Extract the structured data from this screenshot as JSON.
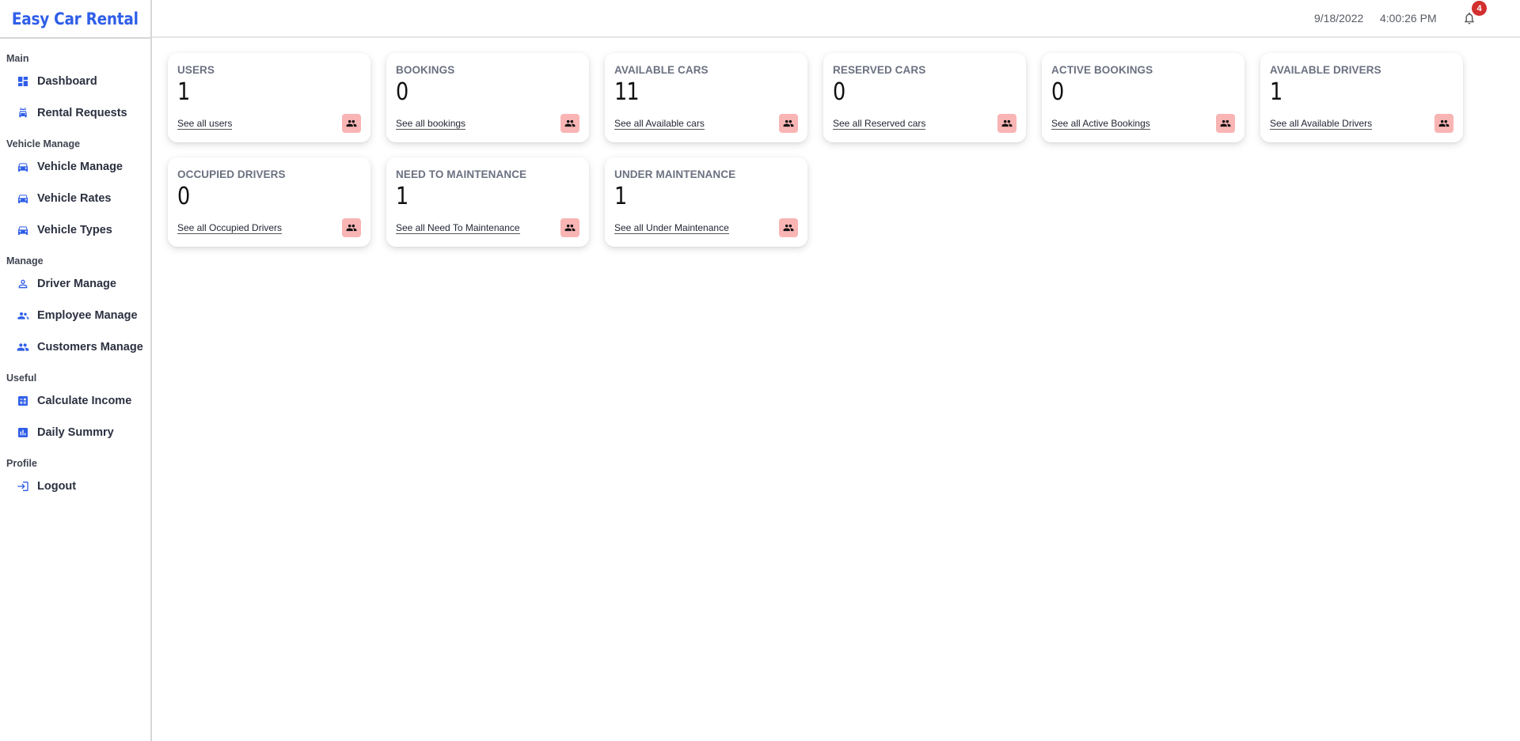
{
  "app": {
    "title": "Easy Car Rental"
  },
  "topbar": {
    "date": "9/18/2022",
    "time": "4:00:26 PM",
    "notification_count": "4"
  },
  "sidebar": {
    "sections": [
      {
        "label": "Main",
        "items": [
          {
            "label": "Dashboard",
            "icon": "dashboard-icon"
          },
          {
            "label": "Rental Requests",
            "icon": "car-rental-icon"
          }
        ]
      },
      {
        "label": "Vehicle Manage",
        "items": [
          {
            "label": "Vehicle Manage",
            "icon": "car-icon"
          },
          {
            "label": "Vehicle Rates",
            "icon": "car-icon"
          },
          {
            "label": "Vehicle Types",
            "icon": "car-icon"
          }
        ]
      },
      {
        "label": "Manage",
        "items": [
          {
            "label": "Driver Manage",
            "icon": "person-icon"
          },
          {
            "label": "Employee Manage",
            "icon": "people-icon"
          },
          {
            "label": "Customers Manage",
            "icon": "group-icon"
          }
        ]
      },
      {
        "label": "Useful",
        "items": [
          {
            "label": "Calculate Income",
            "icon": "calculator-icon"
          },
          {
            "label": "Daily Summry",
            "icon": "bar-chart-icon"
          }
        ]
      },
      {
        "label": "Profile",
        "items": [
          {
            "label": "Logout",
            "icon": "logout-icon"
          }
        ]
      }
    ]
  },
  "cards": [
    {
      "title": "USERS",
      "value": "1",
      "link": "See all users",
      "icon": "group-icon"
    },
    {
      "title": "BOOKINGS",
      "value": "0",
      "link": "See all bookings",
      "icon": "group-icon"
    },
    {
      "title": "AVAILABLE CARS",
      "value": "11",
      "link": "See all Available cars",
      "icon": "group-icon"
    },
    {
      "title": "RESERVED CARS",
      "value": "0",
      "link": "See all Reserved cars",
      "icon": "group-icon"
    },
    {
      "title": "ACTIVE BOOKINGS",
      "value": "0",
      "link": "See all Active Bookings",
      "icon": "group-icon"
    },
    {
      "title": "AVAILABLE DRIVERS",
      "value": "1",
      "link": "See all Available Drivers",
      "icon": "group-icon"
    },
    {
      "title": "OCCUPIED DRIVERS",
      "value": "0",
      "link": "See all Occupied Drivers",
      "icon": "group-icon"
    },
    {
      "title": "NEED TO MAINTENANCE",
      "value": "1",
      "link": "See all Need To Maintenance",
      "icon": "group-icon"
    },
    {
      "title": "UNDER MAINTENANCE",
      "value": "1",
      "link": "See all Under Maintenance",
      "icon": "group-icon"
    }
  ],
  "colors": {
    "accent": "#2f5ee8",
    "card_icon_bg": "#f9b4b4",
    "badge": "#d32f2f"
  }
}
